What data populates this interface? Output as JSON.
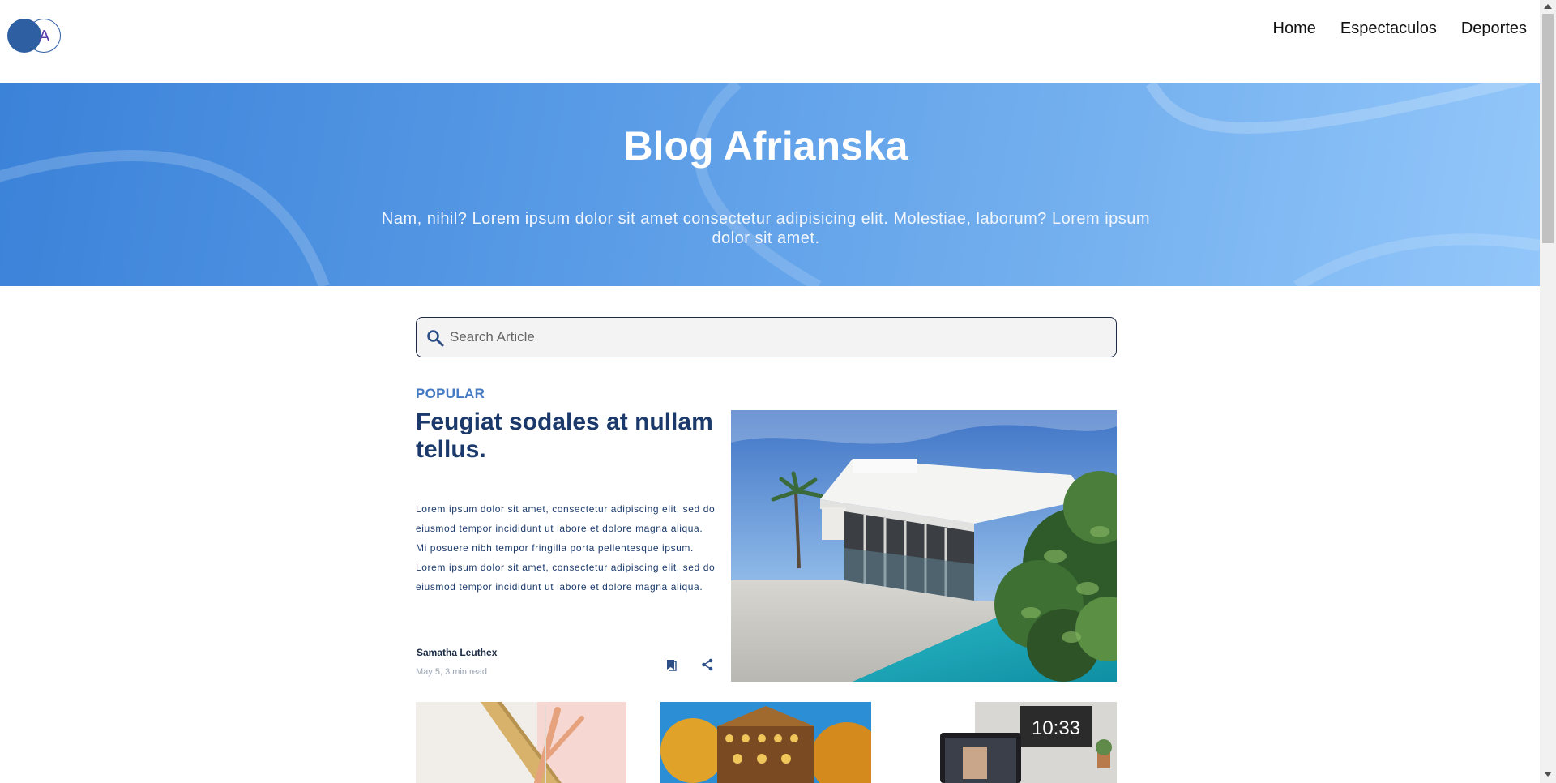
{
  "brand": {
    "logo_letter": "A"
  },
  "nav": {
    "items": [
      "Home",
      "Espectaculos",
      "Deportes"
    ]
  },
  "hero": {
    "title": "Blog Afrianska",
    "subtitle": "Nam, nihil? Lorem ipsum dolor sit amet consectetur adipisicing elit. Molestiae, laborum? Lorem ipsum dolor sit amet."
  },
  "search": {
    "placeholder": "Search Article",
    "icon": "search-icon"
  },
  "popular": {
    "tag": "POPULAR",
    "title": "Feugiat sodales at nullam tellus.",
    "excerpt": "Lorem ipsum dolor sit amet, consectetur adipiscing elit, sed do eiusmod tempor incididunt ut labore et dolore magna aliqua. Mi posuere nibh tempor fringilla porta pellentesque ipsum. Lorem ipsum dolor sit amet, consectetur adipiscing elit, sed do eiusmod tempor incididunt ut labore et dolore magna aliqua.",
    "author": "Samatha Leuthex",
    "meta": "May 5, 3 min read",
    "actions": [
      "bookmark-icon",
      "share-icon"
    ]
  },
  "colors": {
    "accent": "#4479c4",
    "title": "#1b3a6b",
    "hero_start": "#3b82d9",
    "hero_end": "#93c7fa",
    "logo": "#2f5fa3"
  }
}
